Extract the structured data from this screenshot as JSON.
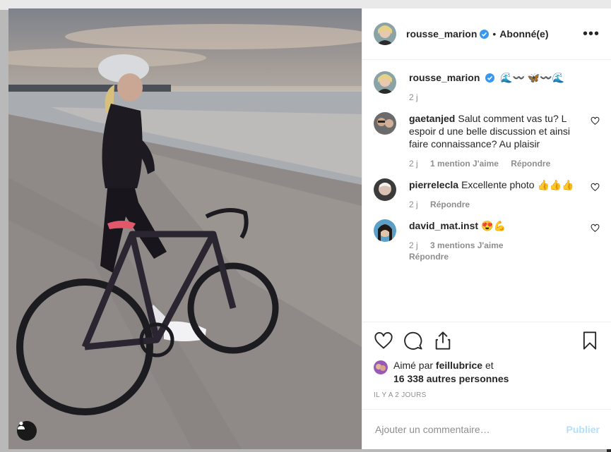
{
  "post": {
    "author": "rousse_marion",
    "follow_status": "Abonné(e)",
    "more_icon": "more-horizontal-icon",
    "colors": {
      "text": "#262626",
      "muted": "#8e8e8e",
      "verified": "#3897f0",
      "publish": "#b2dffc"
    }
  },
  "caption": {
    "author": "rousse_marion",
    "text": "🌊〰️ 🦋〰️🌊",
    "time": "2 j"
  },
  "comments": [
    {
      "author": "gaetanjed",
      "text": "Salut comment vas tu? L espoir d une belle discussion et ainsi faire connaissance? Au plaisir",
      "time": "2 j",
      "likes": "1 mention J'aime",
      "reply": "Répondre"
    },
    {
      "author": "pierrelecla",
      "text": "Excellente photo 👍👍👍",
      "time": "2 j",
      "likes": "",
      "reply": "Répondre"
    },
    {
      "author": "david_mat.inst",
      "text": "😍💪",
      "time": "2 j",
      "likes": "3 mentions J'aime",
      "reply": "Répondre"
    }
  ],
  "likes": {
    "prefix": "Aimé par",
    "user": "feillubrice",
    "connector": "et",
    "others": "16 338 autres personnes"
  },
  "timestamp": "IL Y A 2 JOURS",
  "add_comment": {
    "placeholder": "Ajouter un commentaire…",
    "publish_label": "Publier"
  }
}
